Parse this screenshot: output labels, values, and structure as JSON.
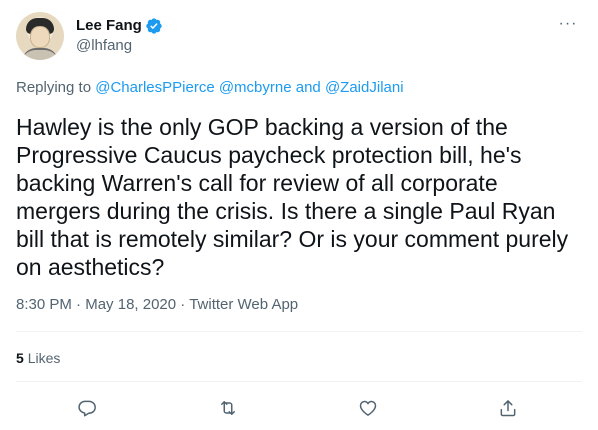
{
  "tweet": {
    "author": {
      "display_name": "Lee Fang",
      "handle": "@lhfang",
      "verified": true
    },
    "replying": {
      "prefix": "Replying to",
      "mentions": [
        "@CharlesPPierce",
        "@mcbyrne"
      ],
      "conjunction": "and",
      "last_mention": "@ZaidJilani"
    },
    "text": "Hawley is the only GOP backing a version of the Progressive Caucus paycheck protection bill, he's backing Warren's call for review of all corporate mergers during the crisis. Is there a single Paul Ryan bill that is remotely similar? Or is your comment purely on aesthetics?",
    "meta": {
      "time": "8:30 PM",
      "separator": "·",
      "date": "May 18, 2020",
      "source": "Twitter Web App"
    },
    "stats": {
      "likes_count": "5",
      "likes_label": "Likes"
    },
    "more_symbol": "···",
    "actions": [
      "reply-icon",
      "retweet-icon",
      "like-icon",
      "share-icon"
    ]
  },
  "colors": {
    "text": "#0f1419",
    "secondary": "#536471",
    "accent": "#1d9bf0",
    "divider": "#eff3f4"
  }
}
